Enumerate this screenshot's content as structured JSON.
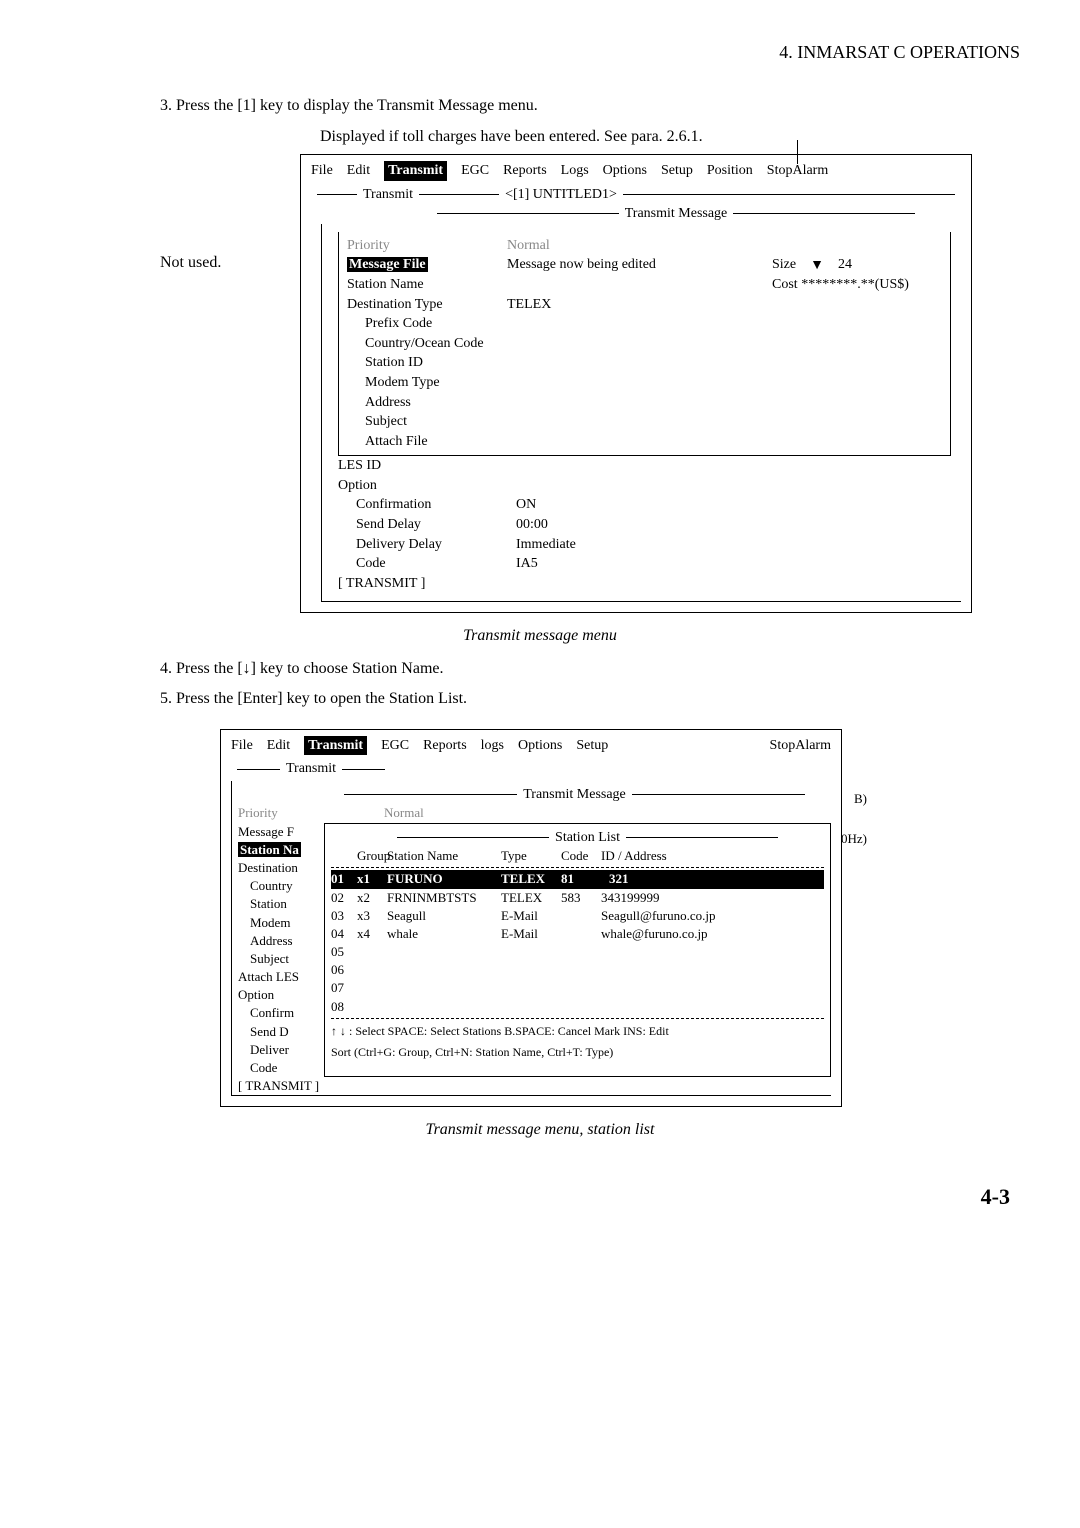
{
  "header": "4. INMARSAT C OPERATIONS",
  "step3": "3.  Press the [1] key to display the Transmit Message menu.",
  "note_toll": "Displayed if toll charges have been entered. See para. 2.6.1.",
  "annot_not_used": "Not used.",
  "menubar": {
    "file": "File",
    "edit": "Edit",
    "transmit": "Transmit",
    "egc": "EGC",
    "reports": "Reports",
    "logs": "Logs",
    "logs2": "logs",
    "options": "Options",
    "setup": "Setup",
    "position": "Position",
    "stopalarm": "StopAlarm"
  },
  "fig1": {
    "transmit_label": "Transmit",
    "untitled": "<[1] UNTITLED1>",
    "transmit_message": "Transmit Message",
    "priority": "Priority",
    "priority_val": "Normal",
    "message_file": "Message File",
    "message_file_val": "Message now being edited",
    "size_label": "Size",
    "size_val": "24",
    "cost_label": "Cost",
    "cost_val": "********.**(US$)",
    "station_name": "Station Name",
    "dest_type": "Destination Type",
    "dest_type_val": "TELEX",
    "prefix": "Prefix Code",
    "country_ocean": "Country/Ocean Code",
    "station_id": "Station ID",
    "modem_type": "Modem Type",
    "address": "Address",
    "subject": "Subject",
    "attach_file": "Attach File",
    "les_id": "LES ID",
    "option": "Option",
    "confirmation": "Confirmation",
    "confirmation_val": "ON",
    "send_delay": "Send Delay",
    "send_delay_val": "00:00",
    "delivery_delay": "Delivery Delay",
    "delivery_delay_val": "Immediate",
    "code": "Code",
    "code_val": "IA5",
    "transmit_btn": "[   TRANSMIT   ]"
  },
  "caption1": "Transmit message menu",
  "step4": "4.  Press the [↓] key to choose Station Name.",
  "step5": "5.  Press the [Enter] key to open the Station List.",
  "fig2": {
    "transmit_label": "Transmit",
    "transmit_message": "Transmit Message",
    "priority": "Priority",
    "priority_val": "Normal",
    "message_f": "Message F",
    "station_na": "Station Na",
    "destination": "Destination",
    "country": "Country",
    "station": "Station",
    "modem": "Modem",
    "address": "Address",
    "subject": "Subject",
    "attach_les": "Attach LES",
    "option": "Option",
    "confirm": "Confirm",
    "send_d": "Send D",
    "deliver": "Deliver",
    "code": "Code",
    "transmit_btn": "[   TRANSMIT   ]",
    "station_list": "Station List",
    "col_group": "Group",
    "col_name": "Station Name",
    "col_type": "Type",
    "col_code": "Code",
    "col_addr": "ID / Address",
    "rows": [
      {
        "num": "01",
        "grp": "x1",
        "name": "FURUNO",
        "type": "TELEX",
        "code": "81",
        "addr": "321"
      },
      {
        "num": "02",
        "grp": "x2",
        "name": "FRNINMBTSTS",
        "type": "TELEX",
        "code": "583",
        "addr": "343199999"
      },
      {
        "num": "03",
        "grp": "x3",
        "name": "Seagull",
        "type": "E-Mail",
        "code": "",
        "addr": "Seagull@furuno.co.jp"
      },
      {
        "num": "04",
        "grp": "x4",
        "name": "whale",
        "type": "E-Mail",
        "code": "",
        "addr": "whale@furuno.co.jp"
      },
      {
        "num": "05",
        "grp": "",
        "name": "",
        "type": "",
        "code": "",
        "addr": ""
      },
      {
        "num": "06",
        "grp": "",
        "name": "",
        "type": "",
        "code": "",
        "addr": ""
      },
      {
        "num": "07",
        "grp": "",
        "name": "",
        "type": "",
        "code": "",
        "addr": ""
      },
      {
        "num": "08",
        "grp": "",
        "name": "",
        "type": "",
        "code": "",
        "addr": ""
      }
    ],
    "hint1": "↑ ↓ : Select   SPACE: Select Stations   B.SPACE: Cancel Mark   INS: Edit",
    "hint2": "Sort (Ctrl+G: Group, Ctrl+N: Station Name, Ctrl+T: Type)",
    "side_b": "B)",
    "side_hz": "0Hz)"
  },
  "caption2": "Transmit message menu, station list",
  "pagenum": "4-3"
}
